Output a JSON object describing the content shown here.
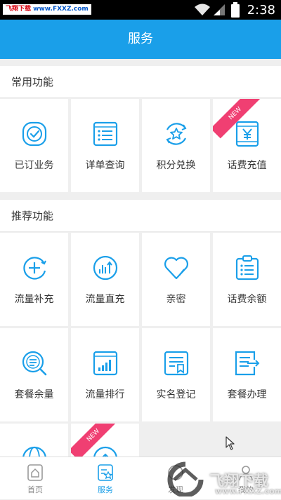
{
  "status_bar": {
    "watermark_red": "飞翔下载",
    "watermark_url": "www.FXXZ.com",
    "time": "2:38"
  },
  "header": {
    "title": "服务"
  },
  "sections": {
    "common": {
      "title": "常用功能"
    },
    "recommended": {
      "title": "推荐功能"
    }
  },
  "common_tiles": [
    {
      "label": "已订业务",
      "icon": "check-circle-icon"
    },
    {
      "label": "详单查询",
      "icon": "list-document-icon"
    },
    {
      "label": "积分兑换",
      "icon": "star-exchange-icon"
    },
    {
      "label": "话费充值",
      "icon": "yuan-card-icon",
      "badge": "NEW"
    }
  ],
  "recommended_tiles": [
    {
      "label": "流量补充",
      "icon": "plus-circle-icon"
    },
    {
      "label": "流量直充",
      "icon": "signal-upload-icon"
    },
    {
      "label": "亲密",
      "icon": "heart-icon"
    },
    {
      "label": "话费余额",
      "icon": "clipboard-icon"
    },
    {
      "label": "套餐余量",
      "icon": "magnifier-list-icon"
    },
    {
      "label": "流量排行",
      "icon": "bar-chart-icon"
    },
    {
      "label": "实名登记",
      "icon": "document-bookmark-icon"
    },
    {
      "label": "套餐办理",
      "icon": "document-arrow-icon"
    },
    {
      "label": "",
      "icon": "globe-icon"
    },
    {
      "label": "",
      "icon": "upload-circle-icon",
      "badge": "NEW"
    }
  ],
  "tabbar": [
    {
      "label": "首页",
      "icon": "home-icon"
    },
    {
      "label": "服务",
      "icon": "service-icon",
      "active": true
    },
    {
      "label": "发现",
      "icon": "discover-icon"
    },
    {
      "label": "我的",
      "icon": "user-icon"
    }
  ],
  "watermark_bottom": {
    "text": "飞翔下载",
    "url": "www.FXXZ.com"
  },
  "colors": {
    "accent": "#1a9fe9",
    "badge": "#f03f72",
    "background": "#efefef"
  }
}
